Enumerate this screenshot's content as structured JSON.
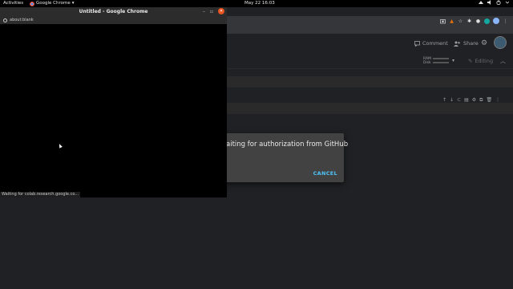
{
  "topbar": {
    "activities": "Activities",
    "app_name": "Google Chrome",
    "app_menu_arrow": "▾",
    "clock": "May 22  16:03"
  },
  "colab": {
    "comment_label": "Comment",
    "share_label": "Share",
    "ram_label": "RAM",
    "disk_label": "Disk",
    "editing_label": "Editing"
  },
  "dialog": {
    "message": "aiting for authorization from GitHub",
    "cancel_label": "CANCEL"
  },
  "popup": {
    "title": "Untitled - Google Chrome",
    "url": "about:blank",
    "status": "Waiting for colab.research.google.co..."
  },
  "colors": {
    "accent_link": "#4fc3f7",
    "ubuntu_close": "#e95420"
  }
}
